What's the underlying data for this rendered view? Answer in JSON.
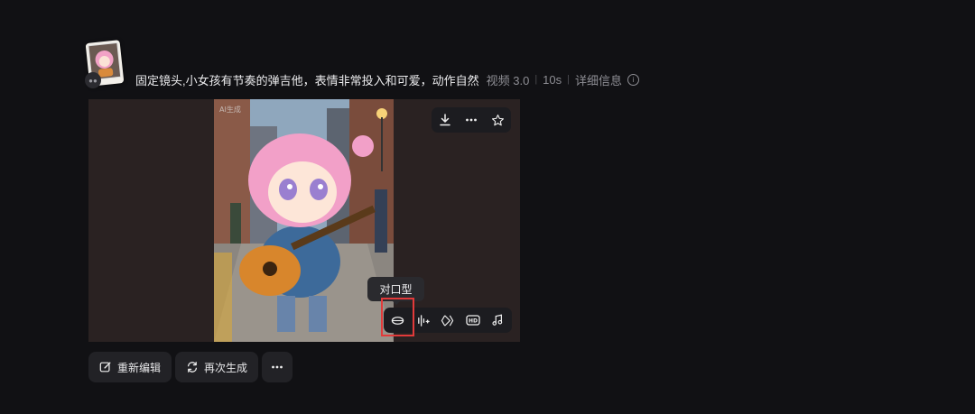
{
  "header": {
    "prompt": "固定镜头,小女孩有节奏的弹吉他，表情非常投入和可爱，动作自然",
    "model": "视频 3.0",
    "duration": "10s",
    "details_label": "详细信息"
  },
  "player": {
    "top_toolbar": {
      "icons": [
        "download-icon",
        "more-icon",
        "star-icon"
      ]
    },
    "bottom_toolbar": {
      "icons": [
        "lip-sync-icon",
        "audio-wave-icon",
        "extend-icon",
        "hd-icon",
        "music-icon"
      ],
      "hd_text": "HD"
    },
    "tooltip": "对口型"
  },
  "actions": {
    "re_edit": "重新编辑",
    "regenerate": "再次生成"
  },
  "colors": {
    "background": "#111114",
    "panel": "#1c1c20",
    "highlight": "#e23a3a"
  }
}
